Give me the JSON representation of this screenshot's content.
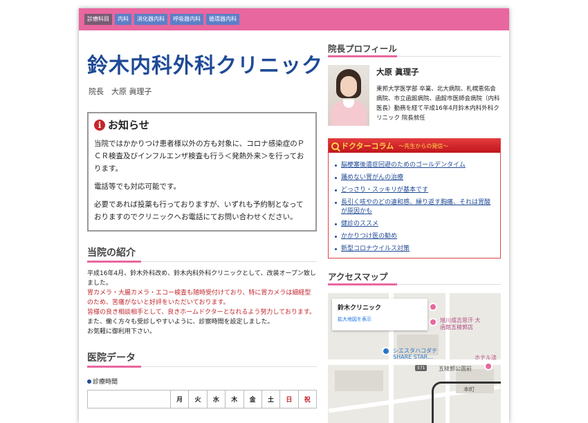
{
  "topnav": {
    "tags": [
      "診療科目",
      "内科",
      "消化器内科",
      "呼吸器内科",
      "循環器内科"
    ]
  },
  "header": {
    "title": "鈴木内科外科クリニック",
    "director": "院長　大原 眞理子"
  },
  "notice": {
    "title": "お知らせ",
    "paragraphs": [
      "当院ではかかりつけ患者様以外の方も対象に、コロナ感染症のＰＣＲ検査及びインフルエンザ検査も行う＜発熱外来＞を行っております。",
      "電話等でも対応可能です。",
      "必要であれば投薬も行っておりますが、いずれも予約制となっておりますのでクリニックへお電話にてお問い合わせください。"
    ]
  },
  "intro": {
    "title": "当院の紹介",
    "line1": "平成16年4月、鈴木外科改め、鈴木内科外科クリニックとして、改装オープン致しました。",
    "line2": "胃カメラ・大腸カメラ・エコー検査も随時受付けており、特に胃カメラは細経型のため、苦痛がないと好評をいただいております。",
    "line3": "皆様の良き相談相手として、良きホームドクターとなれるよう努力しております。",
    "line4": "また、働く方々も受診しやすいように、診察時間を設定しました。",
    "line5": "お気軽に御利用下さい。"
  },
  "hospital_data": {
    "title": "医院データ",
    "hours_label": "診療時間",
    "days": [
      "月",
      "火",
      "水",
      "木",
      "金",
      "土",
      "日",
      "祝"
    ]
  },
  "profile": {
    "section_title": "院長プロフィール",
    "name": "大原 眞理子",
    "bio": "東邦大学医学部 卒業、北大病院、札幌恵佑会病院、市立函館病院、函館市医師会病院（内科医長）勤務を経て平成16年4月鈴木内科外科クリニック 院長就任"
  },
  "doctor_column": {
    "title": "ドクターコラム",
    "subtitle": "～先生からの発信～",
    "items": [
      "脳梗塞後遺症回避のためのゴールデンタイム",
      "踊めない胃がんの治療",
      "どっさり・スッキリが基本です",
      "長引く咳やのどの違和感、繰り返す胸痛、それは胃酸が原因かも",
      "健診のススメ",
      "かかりつけ医の勧め",
      "新型コロナウイルス対策"
    ]
  },
  "access": {
    "section_title": "アクセスマップ",
    "card_name": "鈴木クリニック",
    "card_link": "拡大地図を表示",
    "labels": [
      "旭川成吉思汗 大",
      "函館五稜郭店",
      "シエスタハコダテ",
      "SHARE STAR…",
      "五稜郭公園前",
      "ホテル法",
      "本町",
      "571"
    ]
  }
}
